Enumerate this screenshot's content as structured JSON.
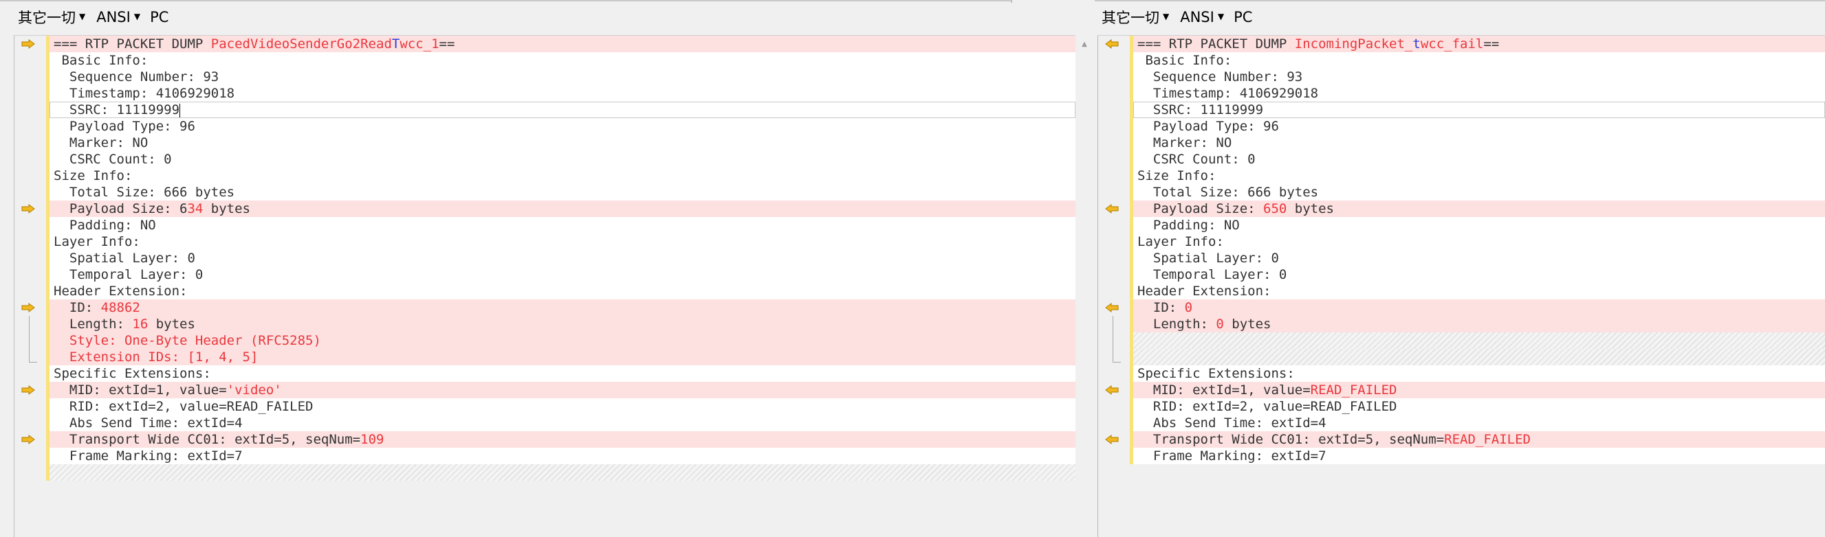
{
  "toolbar": {
    "left": {
      "encoding_group": "其它一切",
      "charset": "ANSI",
      "line_ending": "PC"
    },
    "right": {
      "encoding_group": "其它一切",
      "charset": "ANSI",
      "line_ending": "PC"
    }
  },
  "colors": {
    "diff_highlight": "#fde0e0",
    "diff_text": "#e8383d",
    "diff_char": "#2a3dd8",
    "change_bar": "#fae376",
    "marker": "#f2b81f"
  },
  "icons": {
    "left_marker": "arrow-right-icon",
    "right_marker": "arrow-left-icon",
    "scroll": "scroll-up-icon"
  },
  "left": {
    "lines": [
      {
        "hl": true,
        "marker": true,
        "parts": [
          {
            "t": "=== RTP PACKET DUMP "
          },
          {
            "t": "PacedVideoSenderGo2Read",
            "c": "d"
          },
          {
            "t": "T",
            "c": "b"
          },
          {
            "t": "wcc_1",
            "c": "d"
          },
          {
            "t": "=="
          }
        ]
      },
      {
        "parts": [
          {
            "t": " Basic Info:"
          }
        ]
      },
      {
        "parts": [
          {
            "t": "  Sequence Number: 93"
          }
        ]
      },
      {
        "parts": [
          {
            "t": "  Timestamp: 4106929018"
          }
        ]
      },
      {
        "cursor": true,
        "parts": [
          {
            "t": "  SSRC: 11119999"
          }
        ]
      },
      {
        "parts": [
          {
            "t": "  Payload Type: 96"
          }
        ]
      },
      {
        "parts": [
          {
            "t": "  Marker: NO"
          }
        ]
      },
      {
        "parts": [
          {
            "t": "  CSRC Count: 0"
          }
        ]
      },
      {
        "parts": [
          {
            "t": "Size Info:"
          }
        ]
      },
      {
        "parts": [
          {
            "t": "  Total Size: 666 bytes"
          }
        ]
      },
      {
        "hl": true,
        "marker": true,
        "parts": [
          {
            "t": "  Payload Size: 6"
          },
          {
            "t": "34",
            "c": "d"
          },
          {
            "t": " bytes"
          }
        ]
      },
      {
        "parts": [
          {
            "t": "  Padding: NO"
          }
        ]
      },
      {
        "parts": [
          {
            "t": "Layer Info:"
          }
        ]
      },
      {
        "parts": [
          {
            "t": "  Spatial Layer: 0"
          }
        ]
      },
      {
        "parts": [
          {
            "t": "  Temporal Layer: 0"
          }
        ]
      },
      {
        "parts": [
          {
            "t": "Header Extension:"
          }
        ]
      },
      {
        "hl": true,
        "marker": true,
        "parts": [
          {
            "t": "  ID: "
          },
          {
            "t": "48862",
            "c": "d"
          }
        ]
      },
      {
        "hl": true,
        "parts": [
          {
            "t": "  Length: "
          },
          {
            "t": "16",
            "c": "d"
          },
          {
            "t": " bytes"
          }
        ]
      },
      {
        "hl": true,
        "parts": [
          {
            "t": "  "
          },
          {
            "t": "Style: One-Byte Header (RFC5285)",
            "c": "d"
          }
        ]
      },
      {
        "hl": true,
        "parts": [
          {
            "t": "  "
          },
          {
            "t": "Extension IDs: [1, 4, 5]",
            "c": "d"
          }
        ]
      },
      {
        "parts": [
          {
            "t": "Specific Extensions:"
          }
        ]
      },
      {
        "hl": true,
        "marker": true,
        "parts": [
          {
            "t": "  MID: extId=1, value="
          },
          {
            "t": "'video'",
            "c": "d"
          }
        ]
      },
      {
        "parts": [
          {
            "t": "  RID: extId=2, value=READ_FAILED"
          }
        ]
      },
      {
        "parts": [
          {
            "t": "  Abs Send Time: extId=4"
          }
        ]
      },
      {
        "hl": true,
        "marker": true,
        "parts": [
          {
            "t": "  Transport Wide CC01: extId=5, seqNum="
          },
          {
            "t": "109",
            "c": "d"
          }
        ]
      },
      {
        "parts": [
          {
            "t": "  Frame Marking: extId=7"
          }
        ]
      },
      {
        "hatch": true,
        "parts": []
      }
    ]
  },
  "right": {
    "lines": [
      {
        "hl": true,
        "marker": true,
        "parts": [
          {
            "t": "=== RTP PACKET DUMP "
          },
          {
            "t": "IncomingPacket_",
            "c": "d"
          },
          {
            "t": "t",
            "c": "b"
          },
          {
            "t": "wcc_fail",
            "c": "d"
          },
          {
            "t": "=="
          }
        ]
      },
      {
        "parts": [
          {
            "t": " Basic Info:"
          }
        ]
      },
      {
        "parts": [
          {
            "t": "  Sequence Number: 93"
          }
        ]
      },
      {
        "parts": [
          {
            "t": "  Timestamp: 4106929018"
          }
        ]
      },
      {
        "cursor": true,
        "parts": [
          {
            "t": "  SSRC: 11119999"
          }
        ]
      },
      {
        "parts": [
          {
            "t": "  Payload Type: 96"
          }
        ]
      },
      {
        "parts": [
          {
            "t": "  Marker: NO"
          }
        ]
      },
      {
        "parts": [
          {
            "t": "  CSRC Count: 0"
          }
        ]
      },
      {
        "parts": [
          {
            "t": "Size Info:"
          }
        ]
      },
      {
        "parts": [
          {
            "t": "  Total Size: 666 bytes"
          }
        ]
      },
      {
        "hl": true,
        "marker": true,
        "parts": [
          {
            "t": "  Payload Size: "
          },
          {
            "t": "650",
            "c": "d"
          },
          {
            "t": " bytes"
          }
        ]
      },
      {
        "parts": [
          {
            "t": "  Padding: NO"
          }
        ]
      },
      {
        "parts": [
          {
            "t": "Layer Info:"
          }
        ]
      },
      {
        "parts": [
          {
            "t": "  Spatial Layer: 0"
          }
        ]
      },
      {
        "parts": [
          {
            "t": "  Temporal Layer: 0"
          }
        ]
      },
      {
        "parts": [
          {
            "t": "Header Extension:"
          }
        ]
      },
      {
        "hl": true,
        "marker": true,
        "parts": [
          {
            "t": "  ID: "
          },
          {
            "t": "0",
            "c": "d"
          }
        ]
      },
      {
        "hl": true,
        "parts": [
          {
            "t": "  Length: "
          },
          {
            "t": "0",
            "c": "d"
          },
          {
            "t": " bytes"
          }
        ]
      },
      {
        "hatch": true,
        "parts": []
      },
      {
        "hatch": true,
        "parts": []
      },
      {
        "parts": [
          {
            "t": "Specific Extensions:"
          }
        ]
      },
      {
        "hl": true,
        "marker": true,
        "parts": [
          {
            "t": "  MID: extId=1, value="
          },
          {
            "t": "READ_FAILED",
            "c": "d"
          }
        ]
      },
      {
        "parts": [
          {
            "t": "  RID: extId=2, value=READ_FAILED"
          }
        ]
      },
      {
        "parts": [
          {
            "t": "  Abs Send Time: extId=4"
          }
        ]
      },
      {
        "hl": true,
        "marker": true,
        "parts": [
          {
            "t": "  Transport Wide CC01: extId=5, seqNum="
          },
          {
            "t": "READ_FAILED",
            "c": "d"
          }
        ]
      },
      {
        "parts": [
          {
            "t": "  Frame Marking: extId=7"
          }
        ]
      }
    ]
  }
}
